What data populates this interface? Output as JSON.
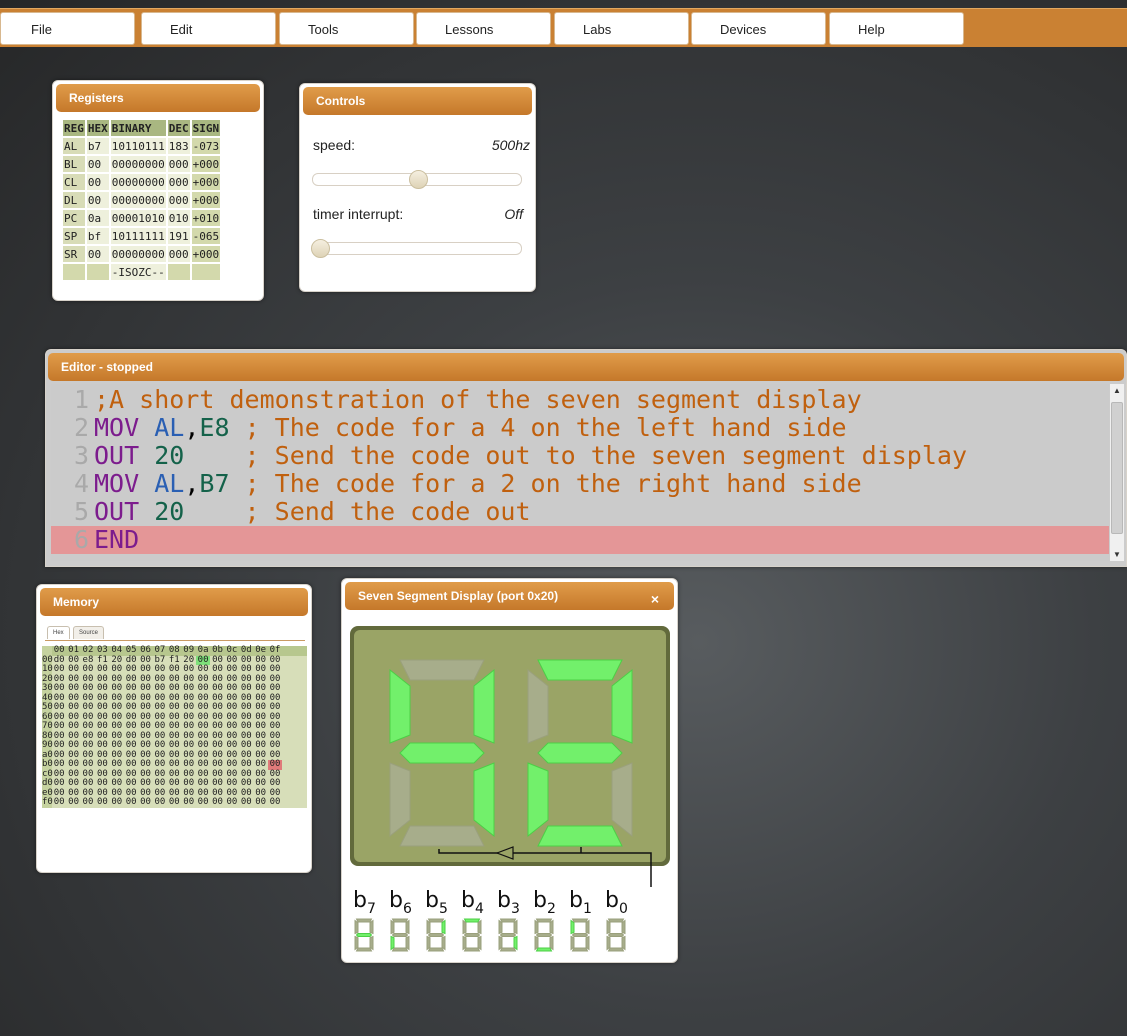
{
  "menu": [
    "File",
    "Edit",
    "Tools",
    "Lessons",
    "Labs",
    "Devices",
    "Help"
  ],
  "registers": {
    "title": "Registers",
    "headers": [
      "REG",
      "HEX",
      "BINARY",
      "DEC",
      "SIGN"
    ],
    "rows": [
      [
        "AL",
        "b7",
        "10110111",
        "183",
        "-073"
      ],
      [
        "BL",
        "00",
        "00000000",
        "000",
        "+000"
      ],
      [
        "CL",
        "00",
        "00000000",
        "000",
        "+000"
      ],
      [
        "DL",
        "00",
        "00000000",
        "000",
        "+000"
      ],
      [
        "PC",
        "0a",
        "00001010",
        "010",
        "+010"
      ],
      [
        "SP",
        "bf",
        "10111111",
        "191",
        "-065"
      ],
      [
        "SR",
        "00",
        "00000000",
        "000",
        "+000"
      ]
    ],
    "flags": "-ISOZC--"
  },
  "controls": {
    "title": "Controls",
    "speed_label": "speed:",
    "speed_value": "500hz",
    "speed_slider": 0.5,
    "timer_label": "timer interrupt:",
    "timer_value": "Off",
    "timer_slider": 0.0
  },
  "editor": {
    "title": "Editor - stopped",
    "lines": [
      ";A short demonstration of the seven segment display",
      "MOV AL,E8 ; The code for a 4 on the left hand side",
      "OUT 20    ; Send the code out to the seven segment display",
      "MOV AL,B7 ; The code for a 2 on the right hand side",
      "OUT 20    ; Send the code out",
      "END"
    ],
    "current_line": 6
  },
  "memory": {
    "title": "Memory",
    "tabs": [
      "Hex",
      "Source"
    ],
    "header": [
      "00",
      "01",
      "02",
      "03",
      "04",
      "05",
      "06",
      "07",
      "08",
      "09",
      "0a",
      "0b",
      "0c",
      "0d",
      "0e",
      "0f"
    ],
    "row_labels": [
      "00",
      "10",
      "20",
      "30",
      "40",
      "50",
      "60",
      "70",
      "80",
      "90",
      "a0",
      "b0",
      "c0",
      "d0",
      "e0",
      "f0"
    ],
    "first_row": [
      "d0",
      "00",
      "e8",
      "f1",
      "20",
      "d0",
      "00",
      "b7",
      "f1",
      "20",
      "00",
      "00",
      "00",
      "00",
      "00",
      "00"
    ],
    "fill": "00",
    "pc_address": 10,
    "sp_address": 191
  },
  "sevenseg": {
    "title": "Seven Segment Display (port 0x20)",
    "close": "×",
    "bits": [
      "b",
      "b",
      "b",
      "b",
      "b",
      "b",
      "b",
      "b"
    ],
    "bit_subs": [
      "7",
      "6",
      "5",
      "4",
      "3",
      "2",
      "1",
      "0"
    ],
    "left_digit_segments": {
      "a": false,
      "b": true,
      "c": true,
      "d": false,
      "e": false,
      "f": true,
      "g": true
    },
    "right_digit_segments": {
      "a": true,
      "b": true,
      "c": false,
      "d": true,
      "e": true,
      "f": false,
      "g": true
    },
    "indicator_segments": [
      "g",
      "e",
      "b",
      "a",
      "c",
      "d",
      "f",
      "none"
    ],
    "colors": {
      "on": "#72f06b",
      "off": "#a7ad8b",
      "screen": "#9aa466"
    }
  }
}
